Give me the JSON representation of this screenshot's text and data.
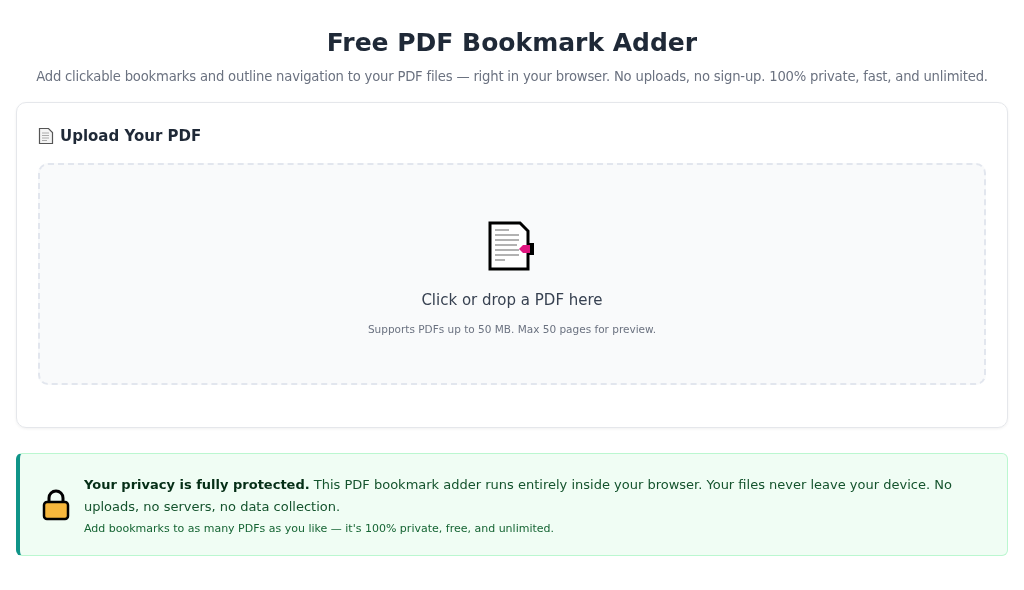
{
  "header": {
    "title": "Free PDF Bookmark Adder",
    "subtitle": "Add clickable bookmarks and outline navigation to your PDF files — right in your browser. No uploads, no sign-up. 100% private, fast, and unlimited."
  },
  "upload_card": {
    "heading": "Upload Your PDF",
    "dropzone": {
      "prompt": "Click or drop a PDF here",
      "hint": "Supports PDFs up to 50 MB. Max 50 pages for preview."
    }
  },
  "privacy_notice": {
    "text": "**Your privacy is fully protected.** This PDF bookmark adder runs entirely inside your browser. Your files never leave your device. No uploads, no servers, no data collection.",
    "note": "Add bookmarks to as many PDFs as you like — it's 100% private, free, and unlimited."
  }
}
